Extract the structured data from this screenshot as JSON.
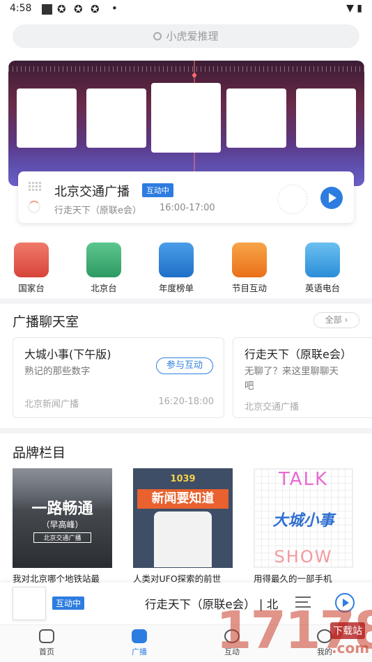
{
  "status": {
    "time": "4:58",
    "dot": "•"
  },
  "search": {
    "placeholder": "小虎爱推理"
  },
  "now_playing": {
    "station": "北京交通广播",
    "badge": "互动中",
    "program": "行走天下（原联e会）",
    "time": "16:00-17:00"
  },
  "categories": [
    {
      "label": "国家台",
      "icon": "tiananmen-icon",
      "color": "#e85a4f"
    },
    {
      "label": "北京台",
      "icon": "map-pin-icon",
      "color": "#3fb07b"
    },
    {
      "label": "年度榜单",
      "icon": "headphones-icon",
      "color": "#2e86de"
    },
    {
      "label": "节目互动",
      "icon": "flame-icon",
      "color": "#f08a24"
    },
    {
      "label": "英语电台",
      "icon": "chat-aa-icon",
      "color": "#3aa6e8"
    }
  ],
  "chat_section": {
    "title": "广播聊天室",
    "all_label": "全部",
    "rooms": [
      {
        "title": "大城小事(下午版)",
        "desc": "熟记的那些数字",
        "source": "北京新闻广播",
        "time": "16:20-18:00",
        "join": "参与互动"
      },
      {
        "title": "行走天下（原联e会）",
        "desc1": "无聊了？来这里聊聊天",
        "desc2": "吧",
        "source": "北京交通广播"
      }
    ]
  },
  "brand_section": {
    "title": "品牌栏目",
    "items": [
      {
        "art_text": "一路畅通",
        "art_sub": "（早高峰）",
        "art_station": "北京交通广播",
        "caption": "我对北京哪个地铁站最"
      },
      {
        "art_code": "1039",
        "art_text": "新闻要知道",
        "caption": "人类对UFO探索的前世"
      },
      {
        "art_top": "TALK",
        "art_text": "大城小事",
        "art_bottom": "SHOW",
        "caption": "用得最久的一部手机"
      }
    ]
  },
  "mini_player": {
    "badge": "互动中",
    "text": "行走天下（原联e会） | 北"
  },
  "tabbar": [
    {
      "label": "首页",
      "icon": "home-icon",
      "active": false
    },
    {
      "label": "广播",
      "icon": "radio-icon",
      "active": true
    },
    {
      "label": "互动",
      "icon": "chat-icon",
      "active": false
    },
    {
      "label": "我的",
      "icon": "profile-icon",
      "active": false
    }
  ],
  "watermark": {
    "text": "17178",
    "tag": "下载站",
    "suffix": ".com"
  }
}
